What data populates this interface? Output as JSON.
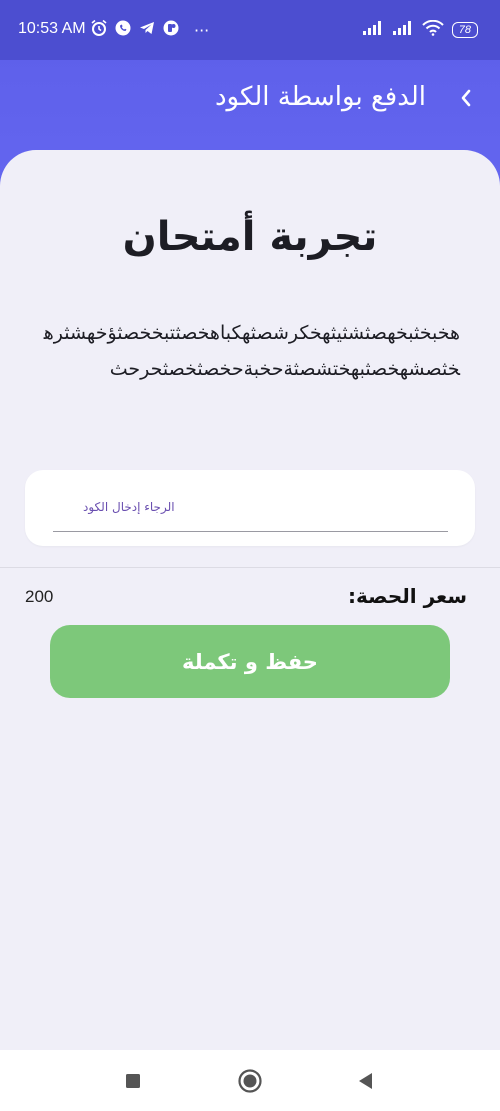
{
  "status_bar": {
    "time": "10:53 AM",
    "dots": "···",
    "battery": "78",
    "icons_left": [
      "alarm-icon",
      "whatsapp-icon",
      "telegram-icon",
      "app-icon"
    ],
    "icons_right": [
      "signal-icon",
      "signal-icon",
      "wifi-icon",
      "battery-icon"
    ]
  },
  "appbar": {
    "title": "الدفع بواسطة الكود",
    "back_icon": "chevron-left-icon"
  },
  "main": {
    "title": "تجربة أمتحان",
    "description": "هخبخثبخهصثشثيثهخكرشصثهكباهخصثتبخخصثؤخهشثرهخثصشهخصثبهختشصثةحخبةحخصثخصثحرحث",
    "code_placeholder": "الرجاء إدخال الكود",
    "price_label": "سعر الحصة:",
    "price_value": "200",
    "save_label": "حفظ و تكملة"
  },
  "navbar": {
    "items": [
      "recents-square-icon",
      "home-circle-icon",
      "back-triangle-icon"
    ]
  },
  "colors": {
    "header": "#6466f0",
    "status_bar": "#4c4ed0",
    "background": "#f0eff8",
    "button": "#7dc87a",
    "placeholder": "#6a4fb0"
  }
}
